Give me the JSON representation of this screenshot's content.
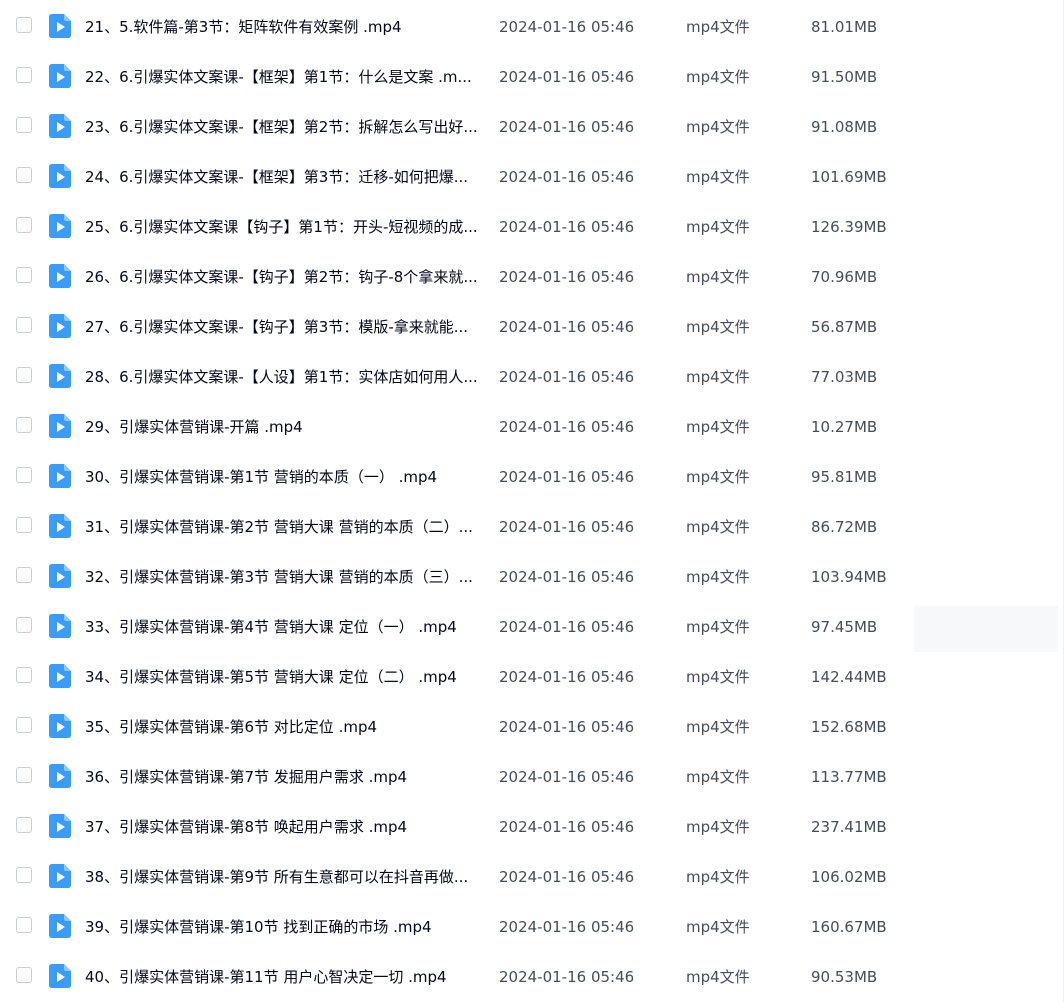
{
  "colors": {
    "icon_blue": "#3b9cf7",
    "text_primary": "#03081a",
    "text_secondary": "#454d5a",
    "checkbox_border": "#c8ccd4",
    "row_hover": "#f7f8fa"
  },
  "hovered_row": 12,
  "file_list": {
    "rows": [
      {
        "name": "21、5.软件篇-第3节：矩阵软件有效案例 .mp4",
        "date": "2024-01-16 05:46",
        "type": "mp4文件",
        "size": "81.01MB",
        "icon": "video-file-icon"
      },
      {
        "name": "22、6.引爆实体文案课-【框架】第1节：什么是文案 .m...",
        "date": "2024-01-16 05:46",
        "type": "mp4文件",
        "size": "91.50MB",
        "icon": "video-file-icon"
      },
      {
        "name": "23、6.引爆实体文案课-【框架】第2节：拆解怎么写出好...",
        "date": "2024-01-16 05:46",
        "type": "mp4文件",
        "size": "91.08MB",
        "icon": "video-file-icon"
      },
      {
        "name": "24、6.引爆实体文案课-【框架】第3节：迁移-如何把爆...",
        "date": "2024-01-16 05:46",
        "type": "mp4文件",
        "size": "101.69MB",
        "icon": "video-file-icon"
      },
      {
        "name": "25、6.引爆实体文案课【钩子】第1节：开头-短视频的成...",
        "date": "2024-01-16 05:46",
        "type": "mp4文件",
        "size": "126.39MB",
        "icon": "video-file-icon"
      },
      {
        "name": "26、6.引爆实体文案课-【钩子】第2节：钩子-8个拿来就...",
        "date": "2024-01-16 05:46",
        "type": "mp4文件",
        "size": "70.96MB",
        "icon": "video-file-icon"
      },
      {
        "name": "27、6.引爆实体文案课-【钩子】第3节：模版-拿来就能...",
        "date": "2024-01-16 05:46",
        "type": "mp4文件",
        "size": "56.87MB",
        "icon": "video-file-icon"
      },
      {
        "name": "28、6.引爆实体文案课-【人设】第1节：实体店如何用人...",
        "date": "2024-01-16 05:46",
        "type": "mp4文件",
        "size": "77.03MB",
        "icon": "video-file-icon"
      },
      {
        "name": "29、引爆实体营销课-开篇 .mp4",
        "date": "2024-01-16 05:46",
        "type": "mp4文件",
        "size": "10.27MB",
        "icon": "video-file-icon"
      },
      {
        "name": "30、引爆实体营销课-第1节 营销的本质（一） .mp4",
        "date": "2024-01-16 05:46",
        "type": "mp4文件",
        "size": "95.81MB",
        "icon": "video-file-icon"
      },
      {
        "name": "31、引爆实体营销课-第2节 营销大课 营销的本质（二）...",
        "date": "2024-01-16 05:46",
        "type": "mp4文件",
        "size": "86.72MB",
        "icon": "video-file-icon"
      },
      {
        "name": "32、引爆实体营销课-第3节 营销大课 营销的本质（三）...",
        "date": "2024-01-16 05:46",
        "type": "mp4文件",
        "size": "103.94MB",
        "icon": "video-file-icon"
      },
      {
        "name": "33、引爆实体营销课-第4节 营销大课 定位（一） .mp4",
        "date": "2024-01-16 05:46",
        "type": "mp4文件",
        "size": "97.45MB",
        "icon": "video-file-icon"
      },
      {
        "name": "34、引爆实体营销课-第5节 营销大课 定位（二） .mp4",
        "date": "2024-01-16 05:46",
        "type": "mp4文件",
        "size": "142.44MB",
        "icon": "video-file-icon"
      },
      {
        "name": "35、引爆实体营销课-第6节 对比定位 .mp4",
        "date": "2024-01-16 05:46",
        "type": "mp4文件",
        "size": "152.68MB",
        "icon": "video-file-icon"
      },
      {
        "name": "36、引爆实体营销课-第7节 发掘用户需求 .mp4",
        "date": "2024-01-16 05:46",
        "type": "mp4文件",
        "size": "113.77MB",
        "icon": "video-file-icon"
      },
      {
        "name": "37、引爆实体营销课-第8节 唤起用户需求 .mp4",
        "date": "2024-01-16 05:46",
        "type": "mp4文件",
        "size": "237.41MB",
        "icon": "video-file-icon"
      },
      {
        "name": "38、引爆实体营销课-第9节 所有生意都可以在抖音再做...",
        "date": "2024-01-16 05:46",
        "type": "mp4文件",
        "size": "106.02MB",
        "icon": "video-file-icon"
      },
      {
        "name": "39、引爆实体营销课-第10节 找到正确的市场 .mp4",
        "date": "2024-01-16 05:46",
        "type": "mp4文件",
        "size": "160.67MB",
        "icon": "video-file-icon"
      },
      {
        "name": "40、引爆实体营销课-第11节 用户心智决定一切 .mp4",
        "date": "2024-01-16 05:46",
        "type": "mp4文件",
        "size": "90.53MB",
        "icon": "video-file-icon"
      }
    ]
  }
}
